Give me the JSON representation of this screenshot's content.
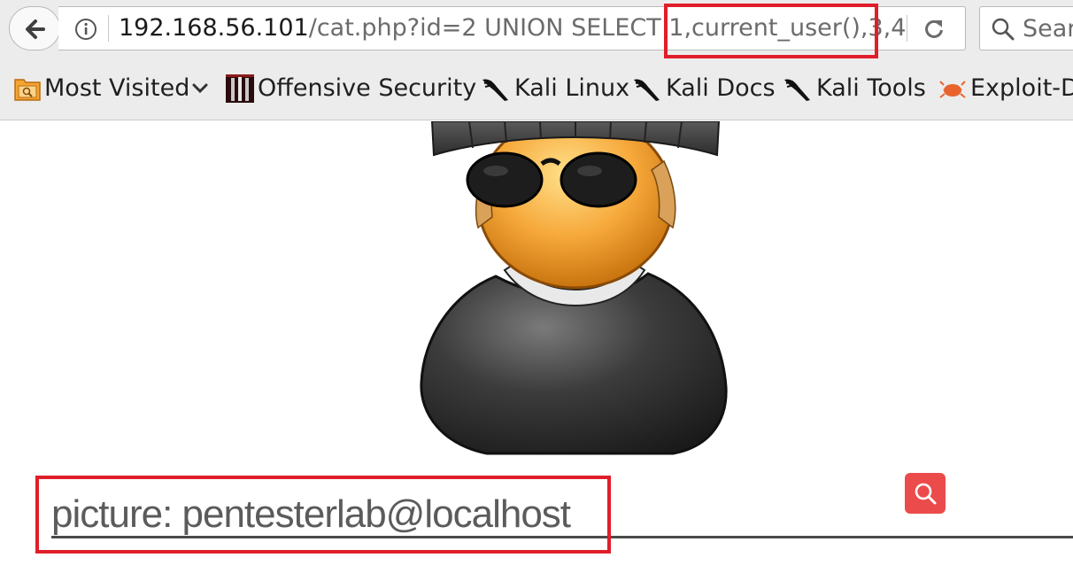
{
  "browser": {
    "url_host": "192.168.56.101",
    "url_path": "/cat.php?id=2 UNION SELECT 1,current_user(),3,4",
    "search_placeholder": "Search"
  },
  "bookmarks": [
    {
      "label": "Most Visited",
      "icon": "folder-icon",
      "has_dropdown": true
    },
    {
      "label": "Offensive Security",
      "icon": "offensive-security-icon"
    },
    {
      "label": "Kali Linux",
      "icon": "kali-dragon-icon"
    },
    {
      "label": "Kali Docs",
      "icon": "kali-dragon-icon"
    },
    {
      "label": "Kali Tools",
      "icon": "kali-dragon-icon"
    },
    {
      "label": "Exploit-DB",
      "icon": "exploit-db-icon"
    }
  ],
  "page": {
    "picture_text": "picture: pentesterlab@localhost"
  },
  "colors": {
    "highlight": "#e01e2a",
    "search_button": "#ec4b4b"
  }
}
